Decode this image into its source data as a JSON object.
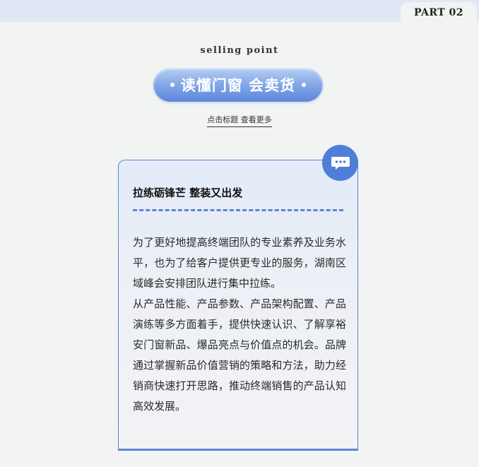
{
  "header": {
    "part_label": "PART 02"
  },
  "section": {
    "eyebrow": "selling point",
    "title": "读懂门窗 会卖货",
    "more_link": "点击标题 查看更多"
  },
  "card": {
    "icon": "chat-bubble-icon",
    "title": "拉练砺锋芒 整装又出发",
    "paragraph_1": "为了更好地提高终端团队的专业素养及业务水平，也为了给客户提供更专业的服务，湖南区域峰会安排团队进行集中拉练。",
    "paragraph_2": "从产品性能、产品参数、产品架构配置、产品演练等多方面着手，提供快速认识、了解享裕安门窗新品、爆品亮点与价值点的机会。品牌通过掌握新品价值营销的策略和方法，助力经销商快速打开思路，推动终端销售的产品认知高效发展。"
  },
  "colors": {
    "accent": "#5b84d6",
    "badge": "#4f7ed6",
    "page_bg": "#f2f3f3",
    "top_band": "#dfe8f4"
  }
}
